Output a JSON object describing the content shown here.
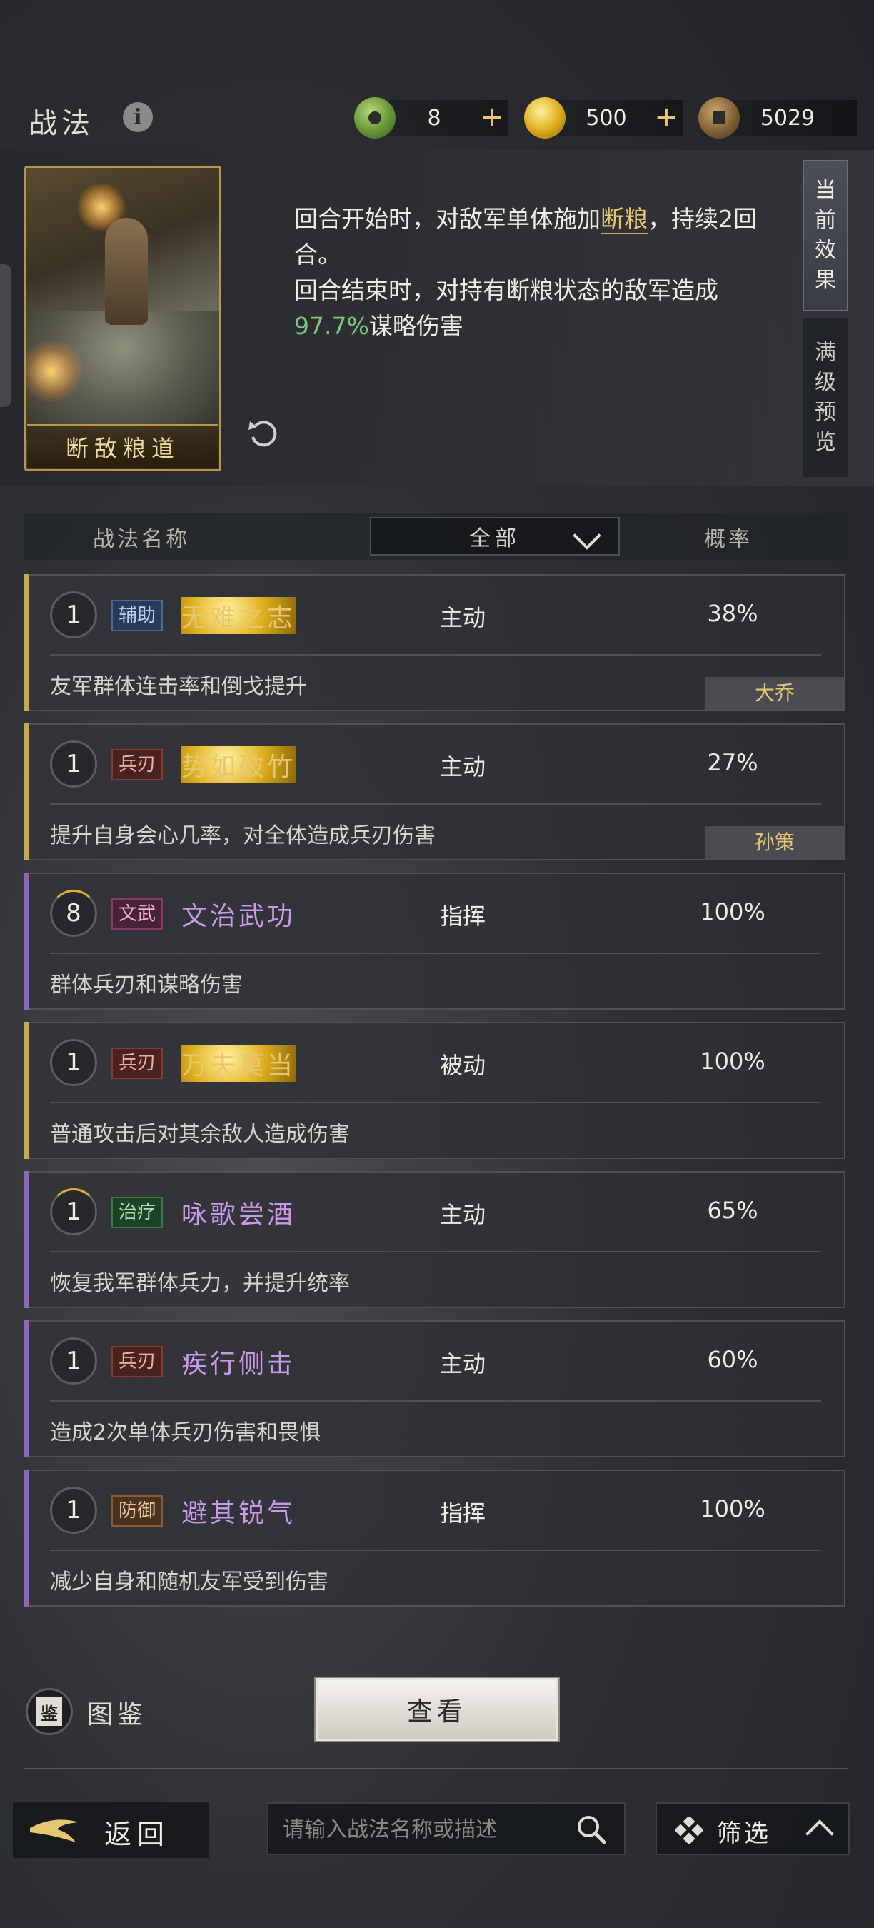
{
  "header": {
    "title": "战法",
    "info_icon": "info-icon",
    "currencies": [
      {
        "icon": "jade-coin-icon",
        "value": "8",
        "has_plus": true
      },
      {
        "icon": "gold-coin-icon",
        "value": "500",
        "has_plus": true
      },
      {
        "icon": "copper-coin-icon",
        "value": "5029",
        "has_plus": false
      }
    ],
    "plus": "+"
  },
  "card": {
    "name": "断敌粮道",
    "refresh_icon": "refresh-icon"
  },
  "effect": {
    "line1_pre": "回合开始时，对敌军单体施加",
    "line1_hl": "断粮",
    "line1_post": "，持续2回合。",
    "line2": "回合结束时，对持有断粮状态的敌军造成",
    "percent": "97.7%",
    "line2_post": "谋略伤害"
  },
  "tabs": {
    "current": [
      "当",
      "前",
      "效",
      "果"
    ],
    "max": [
      "满",
      "级",
      "预",
      "览"
    ]
  },
  "filter": {
    "col_name": "战法名称",
    "dropdown": "全部",
    "col_rate": "概率"
  },
  "skills": [
    {
      "level": "1",
      "tag": "辅助",
      "tag_class": "fuzhu",
      "name": "无难之志",
      "name_color": "gold",
      "type": "主动",
      "rate": "38%",
      "desc": "友军群体连击率和倒戈提升",
      "owner": "大乔",
      "accent": "gold",
      "arc": false
    },
    {
      "level": "1",
      "tag": "兵刃",
      "tag_class": "bingren",
      "name": "势如破竹",
      "name_color": "gold",
      "type": "主动",
      "rate": "27%",
      "desc": "提升自身会心几率，对全体造成兵刃伤害",
      "owner": "孙策",
      "accent": "gold",
      "arc": false
    },
    {
      "level": "8",
      "tag": "文武",
      "tag_class": "wenwu",
      "name": "文治武功",
      "name_color": "purple",
      "type": "指挥",
      "rate": "100%",
      "desc": "群体兵刃和谋略伤害",
      "owner": "",
      "accent": "purple",
      "arc": true
    },
    {
      "level": "1",
      "tag": "兵刃",
      "tag_class": "bingren",
      "name": "万夫莫当",
      "name_color": "gold",
      "type": "被动",
      "rate": "100%",
      "desc": "普通攻击后对其余敌人造成伤害",
      "owner": "",
      "accent": "gold",
      "arc": false
    },
    {
      "level": "1",
      "tag": "治疗",
      "tag_class": "zhiliao",
      "name": "咏歌尝酒",
      "name_color": "purple",
      "type": "主动",
      "rate": "65%",
      "desc": "恢复我军群体兵力，并提升统率",
      "owner": "",
      "accent": "purple",
      "arc": true
    },
    {
      "level": "1",
      "tag": "兵刃",
      "tag_class": "bingren",
      "name": "疾行侧击",
      "name_color": "purple",
      "type": "主动",
      "rate": "60%",
      "desc": "造成2次单体兵刃伤害和畏惧",
      "owner": "",
      "accent": "purple",
      "arc": false
    },
    {
      "level": "1",
      "tag": "防御",
      "tag_class": "fangyu",
      "name": "避其锐气",
      "name_color": "purple",
      "type": "指挥",
      "rate": "100%",
      "desc": "减少自身和随机友军受到伤害",
      "owner": "",
      "accent": "purple",
      "arc": false
    }
  ],
  "bottom": {
    "codex_icon_text": "鉴",
    "codex_label": "图鉴",
    "view_button": "查看",
    "back_label": "返回",
    "search_placeholder": "请输入战法名称或描述",
    "filter_label": "筛选"
  },
  "colors": {
    "accent_gold": "#e6c670",
    "accent_purple": "#c89ae8",
    "percent_green": "#7ec87e"
  }
}
